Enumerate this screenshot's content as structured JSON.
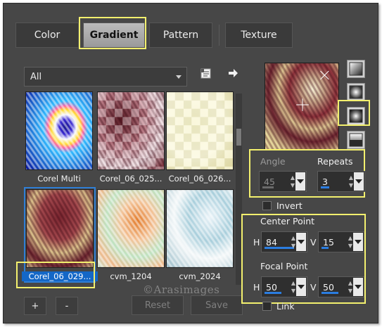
{
  "tabs": [
    {
      "label": "Color"
    },
    {
      "label": "Gradient",
      "active": true
    },
    {
      "label": "Pattern"
    },
    {
      "label": "Texture"
    }
  ],
  "library": {
    "filter_value": "All",
    "items": [
      {
        "name": "Corel Multi"
      },
      {
        "name": "Corel_06_025..."
      },
      {
        "name": "Corel_06_026..."
      },
      {
        "name": "Corel_06_029...",
        "selected": true
      },
      {
        "name": "cvm_1204"
      },
      {
        "name": "cvm_2024"
      }
    ],
    "add_label": "+",
    "remove_label": "-",
    "reset_label": "Reset",
    "save_label": "Save"
  },
  "settings": {
    "angle_label": "Angle",
    "angle_value": "45",
    "repeats_label": "Repeats",
    "repeats_value": "3",
    "invert_label": "Invert",
    "center_point_label": "Center Point",
    "center_h_label": "H",
    "center_h_value": "84",
    "center_v_label": "V",
    "center_v_value": "15",
    "focal_point_label": "Focal Point",
    "focal_h_label": "H",
    "focal_h_value": "50",
    "focal_v_label": "V",
    "focal_v_value": "50",
    "link_label": "Link",
    "gradient_styles": [
      "linear-style-icon",
      "rectangular-style-icon",
      "sunburst-style-icon",
      "radial-style-icon"
    ],
    "active_style": "sunburst-style-icon"
  },
  "watermark": "©Arasimages",
  "colors": {
    "panel": "#474747",
    "highlight": "#f3f06e",
    "selection": "#1467c7"
  }
}
